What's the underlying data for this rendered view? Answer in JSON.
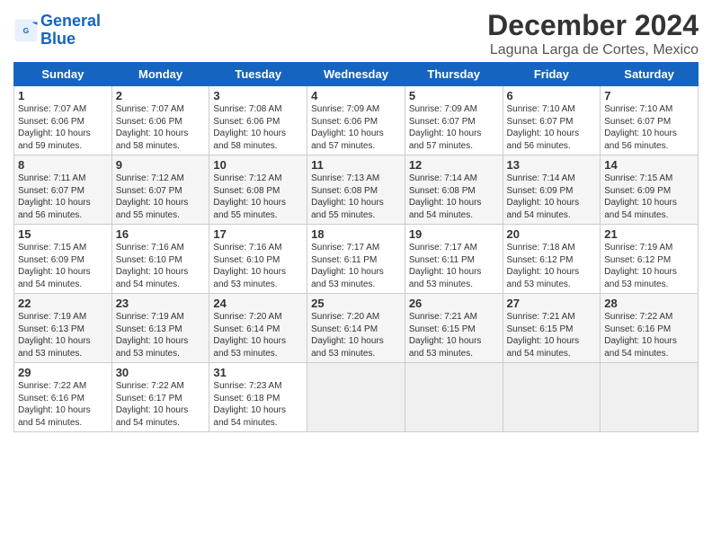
{
  "logo": {
    "line1": "General",
    "line2": "Blue"
  },
  "title": "December 2024",
  "subtitle": "Laguna Larga de Cortes, Mexico",
  "days_of_week": [
    "Sunday",
    "Monday",
    "Tuesday",
    "Wednesday",
    "Thursday",
    "Friday",
    "Saturday"
  ],
  "weeks": [
    [
      {
        "day": 1,
        "sunrise": "7:07 AM",
        "sunset": "6:06 PM",
        "daylight": "10 hours and 59 minutes."
      },
      {
        "day": 2,
        "sunrise": "7:07 AM",
        "sunset": "6:06 PM",
        "daylight": "10 hours and 58 minutes."
      },
      {
        "day": 3,
        "sunrise": "7:08 AM",
        "sunset": "6:06 PM",
        "daylight": "10 hours and 58 minutes."
      },
      {
        "day": 4,
        "sunrise": "7:09 AM",
        "sunset": "6:06 PM",
        "daylight": "10 hours and 57 minutes."
      },
      {
        "day": 5,
        "sunrise": "7:09 AM",
        "sunset": "6:07 PM",
        "daylight": "10 hours and 57 minutes."
      },
      {
        "day": 6,
        "sunrise": "7:10 AM",
        "sunset": "6:07 PM",
        "daylight": "10 hours and 56 minutes."
      },
      {
        "day": 7,
        "sunrise": "7:10 AM",
        "sunset": "6:07 PM",
        "daylight": "10 hours and 56 minutes."
      }
    ],
    [
      {
        "day": 8,
        "sunrise": "7:11 AM",
        "sunset": "6:07 PM",
        "daylight": "10 hours and 56 minutes."
      },
      {
        "day": 9,
        "sunrise": "7:12 AM",
        "sunset": "6:07 PM",
        "daylight": "10 hours and 55 minutes."
      },
      {
        "day": 10,
        "sunrise": "7:12 AM",
        "sunset": "6:08 PM",
        "daylight": "10 hours and 55 minutes."
      },
      {
        "day": 11,
        "sunrise": "7:13 AM",
        "sunset": "6:08 PM",
        "daylight": "10 hours and 55 minutes."
      },
      {
        "day": 12,
        "sunrise": "7:14 AM",
        "sunset": "6:08 PM",
        "daylight": "10 hours and 54 minutes."
      },
      {
        "day": 13,
        "sunrise": "7:14 AM",
        "sunset": "6:09 PM",
        "daylight": "10 hours and 54 minutes."
      },
      {
        "day": 14,
        "sunrise": "7:15 AM",
        "sunset": "6:09 PM",
        "daylight": "10 hours and 54 minutes."
      }
    ],
    [
      {
        "day": 15,
        "sunrise": "7:15 AM",
        "sunset": "6:09 PM",
        "daylight": "10 hours and 54 minutes."
      },
      {
        "day": 16,
        "sunrise": "7:16 AM",
        "sunset": "6:10 PM",
        "daylight": "10 hours and 54 minutes."
      },
      {
        "day": 17,
        "sunrise": "7:16 AM",
        "sunset": "6:10 PM",
        "daylight": "10 hours and 53 minutes."
      },
      {
        "day": 18,
        "sunrise": "7:17 AM",
        "sunset": "6:11 PM",
        "daylight": "10 hours and 53 minutes."
      },
      {
        "day": 19,
        "sunrise": "7:17 AM",
        "sunset": "6:11 PM",
        "daylight": "10 hours and 53 minutes."
      },
      {
        "day": 20,
        "sunrise": "7:18 AM",
        "sunset": "6:12 PM",
        "daylight": "10 hours and 53 minutes."
      },
      {
        "day": 21,
        "sunrise": "7:19 AM",
        "sunset": "6:12 PM",
        "daylight": "10 hours and 53 minutes."
      }
    ],
    [
      {
        "day": 22,
        "sunrise": "7:19 AM",
        "sunset": "6:13 PM",
        "daylight": "10 hours and 53 minutes."
      },
      {
        "day": 23,
        "sunrise": "7:19 AM",
        "sunset": "6:13 PM",
        "daylight": "10 hours and 53 minutes."
      },
      {
        "day": 24,
        "sunrise": "7:20 AM",
        "sunset": "6:14 PM",
        "daylight": "10 hours and 53 minutes."
      },
      {
        "day": 25,
        "sunrise": "7:20 AM",
        "sunset": "6:14 PM",
        "daylight": "10 hours and 53 minutes."
      },
      {
        "day": 26,
        "sunrise": "7:21 AM",
        "sunset": "6:15 PM",
        "daylight": "10 hours and 53 minutes."
      },
      {
        "day": 27,
        "sunrise": "7:21 AM",
        "sunset": "6:15 PM",
        "daylight": "10 hours and 54 minutes."
      },
      {
        "day": 28,
        "sunrise": "7:22 AM",
        "sunset": "6:16 PM",
        "daylight": "10 hours and 54 minutes."
      }
    ],
    [
      {
        "day": 29,
        "sunrise": "7:22 AM",
        "sunset": "6:16 PM",
        "daylight": "10 hours and 54 minutes."
      },
      {
        "day": 30,
        "sunrise": "7:22 AM",
        "sunset": "6:17 PM",
        "daylight": "10 hours and 54 minutes."
      },
      {
        "day": 31,
        "sunrise": "7:23 AM",
        "sunset": "6:18 PM",
        "daylight": "10 hours and 54 minutes."
      },
      null,
      null,
      null,
      null
    ]
  ],
  "labels": {
    "sunrise": "Sunrise:",
    "sunset": "Sunset:",
    "daylight": "Daylight:"
  }
}
